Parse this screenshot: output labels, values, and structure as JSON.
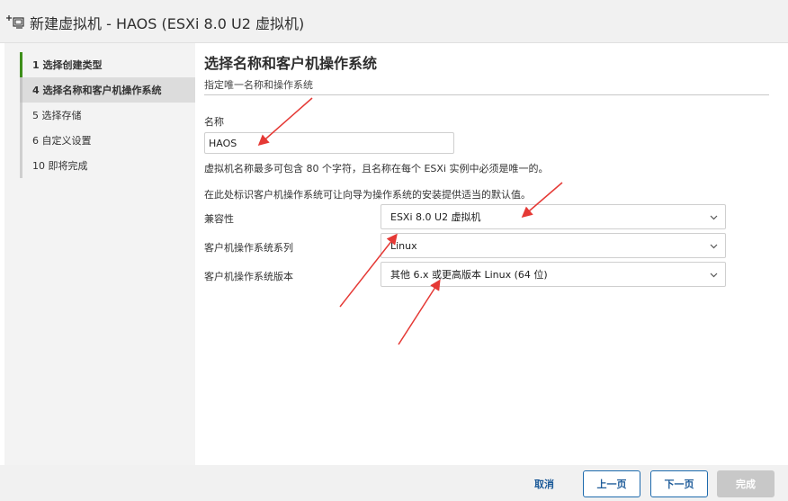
{
  "window": {
    "title": "新建虚拟机 - HAOS (ESXi 8.0 U2 虚拟机)",
    "icon": "new-vm-icon"
  },
  "sidebar": {
    "steps": [
      {
        "label": "1  选择创建类型",
        "state": "done"
      },
      {
        "label": "4  选择名称和客户机操作系统",
        "state": "active"
      },
      {
        "label": "5  选择存储",
        "state": "pending"
      },
      {
        "label": "6  自定义设置",
        "state": "pending"
      },
      {
        "label": "10  即将完成",
        "state": "pending"
      }
    ]
  },
  "main": {
    "heading": "选择名称和客户机操作系统",
    "subheading": "指定唯一名称和操作系统",
    "name_label": "名称",
    "name_value": "HAOS",
    "name_hint": "虚拟机名称最多可包含 80 个字符，且名称在每个 ESXi 实例中必须是唯一的。",
    "os_hint": "在此处标识客户机操作系统可让向导为操作系统的安装提供适当的默认值。",
    "compat_label": "兼容性",
    "compat_value": "ESXi 8.0 U2 虚拟机",
    "family_label": "客户机操作系统系列",
    "family_value": "Linux",
    "version_label": "客户机操作系统版本",
    "version_value": "其他 6.x 或更高版本 Linux (64 位)"
  },
  "footer": {
    "cancel": "取消",
    "prev": "上一页",
    "next": "下一页",
    "finish": "完成"
  },
  "colors": {
    "accent": "#1d6aad",
    "done_bar": "#3e8e1a",
    "annotation_arrow": "#e53935"
  }
}
